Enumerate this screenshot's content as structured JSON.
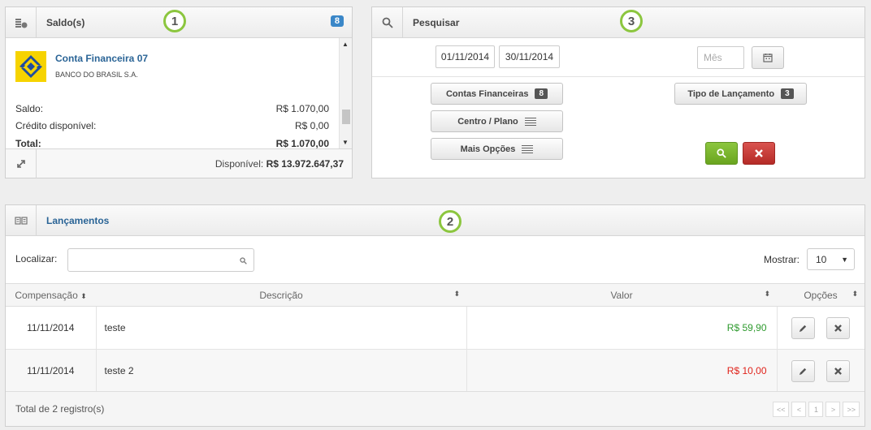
{
  "saldos": {
    "title": "Saldo(s)",
    "count": "8",
    "callout": "1",
    "account": {
      "name": "Conta Financeira 07",
      "bank": "BANCO DO BRASIL S.A.",
      "saldo_label": "Saldo:",
      "saldo_value": "R$ 1.070,00",
      "credito_label": "Crédito disponível:",
      "credito_value": "R$ 0,00",
      "total_label": "Total:",
      "total_value": "R$ 1.070,00"
    },
    "disponivel_label": "Disponível:",
    "disponivel_value": "R$ 13.972.647,37"
  },
  "pesquisar": {
    "title": "Pesquisar",
    "callout": "3",
    "date_from": "01/11/2014",
    "date_to": "30/11/2014",
    "month_placeholder": "Mês",
    "contas_label": "Contas Financeiras",
    "contas_count": "8",
    "centro_label": "Centro / Plano",
    "mais_label": "Mais Opções",
    "tipo_label": "Tipo de Lançamento",
    "tipo_count": "3"
  },
  "lancamentos": {
    "title": "Lançamentos",
    "callout": "2",
    "localizar_label": "Localizar:",
    "mostrar_label": "Mostrar:",
    "mostrar_value": "10",
    "columns": [
      "Compensação",
      "Descrição",
      "Valor",
      "Opções"
    ],
    "rows": [
      {
        "date": "11/11/2014",
        "desc": "teste",
        "valor": "R$ 59,90",
        "tipo": "credit"
      },
      {
        "date": "11/11/2014",
        "desc": "teste 2",
        "valor": "R$ 10,00",
        "tipo": "debit"
      }
    ],
    "total_text": "Total de 2 registro(s)",
    "pager": [
      "<<",
      "<",
      "1",
      ">",
      ">>"
    ]
  },
  "colors": {
    "accent_blue": "#3a87c8",
    "callout_green": "#8cc63f",
    "credit_green": "#2e9a2e",
    "debit_red": "#e0231b",
    "search_button": "#7bb526",
    "clear_button": "#c9302c"
  }
}
